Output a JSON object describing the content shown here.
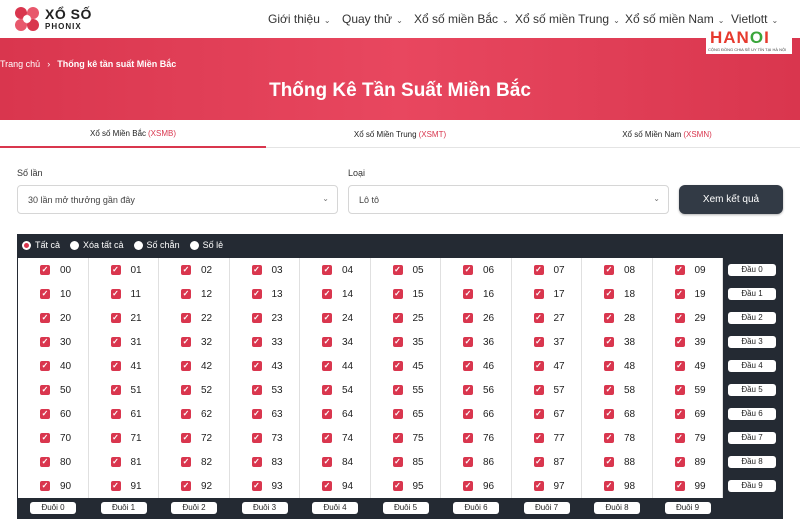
{
  "header": {
    "logo_line1": "XỔ SỐ",
    "logo_line2": "PHONIX",
    "nav": [
      {
        "label": "Giới thiệu",
        "dropdown": true
      },
      {
        "label": "Quay thử",
        "dropdown": true
      },
      {
        "label": "Xổ số miền Bắc",
        "dropdown": true
      },
      {
        "label": "Xổ số miền Trung",
        "dropdown": true
      },
      {
        "label": "Xổ số miền Nam",
        "dropdown": true
      },
      {
        "label": "Vietlott",
        "dropdown": true
      }
    ]
  },
  "watermark": {
    "text": "HANOI",
    "tagline": "CỘNG ĐỒNG CHIA SẺ UY TÍN TẠI HÀ NỘI"
  },
  "breadcrumb": {
    "home": "Trang chủ",
    "separator": "›",
    "current": "Thống kê tần suất Miền Bắc"
  },
  "hero_title": "Thống Kê Tần Suất Miền Bắc",
  "tabs": [
    {
      "label": "Xổ số Miền Bắc",
      "code": "(XSMB)",
      "active": true
    },
    {
      "label": "Xổ số Miền Trung",
      "code": "(XSMT)",
      "active": false
    },
    {
      "label": "Xổ số Miền Nam",
      "code": "(XSMN)",
      "active": false
    }
  ],
  "form": {
    "times_label": "Số lần",
    "times_value": "30 lần mở thưởng gần đây",
    "type_label": "Loại",
    "type_value": "Lô tô",
    "submit_label": "Xem kết quả"
  },
  "filters": [
    {
      "label": "Tất cả",
      "selected": true
    },
    {
      "label": "Xóa tất cả",
      "selected": false
    },
    {
      "label": "Số chẵn",
      "selected": false
    },
    {
      "label": "Số lẻ",
      "selected": false
    }
  ],
  "numbers_checked": true,
  "row_buttons": [
    "Đầu 0",
    "Đầu 1",
    "Đầu 2",
    "Đầu 3",
    "Đầu 4",
    "Đầu 5",
    "Đầu 6",
    "Đầu 7",
    "Đầu 8",
    "Đầu 9"
  ],
  "col_buttons": [
    "Đuôi 0",
    "Đuôi 1",
    "Đuôi 2",
    "Đuôi 3",
    "Đuôi 4",
    "Đuôi 5",
    "Đuôi 6",
    "Đuôi 7",
    "Đuôi 8",
    "Đuôi 9"
  ],
  "colors": {
    "accent": "#d9364e",
    "dark": "#242a33",
    "button": "#323a45"
  },
  "icons": {
    "check": "check-icon",
    "chevron": "chevron-down-icon"
  }
}
